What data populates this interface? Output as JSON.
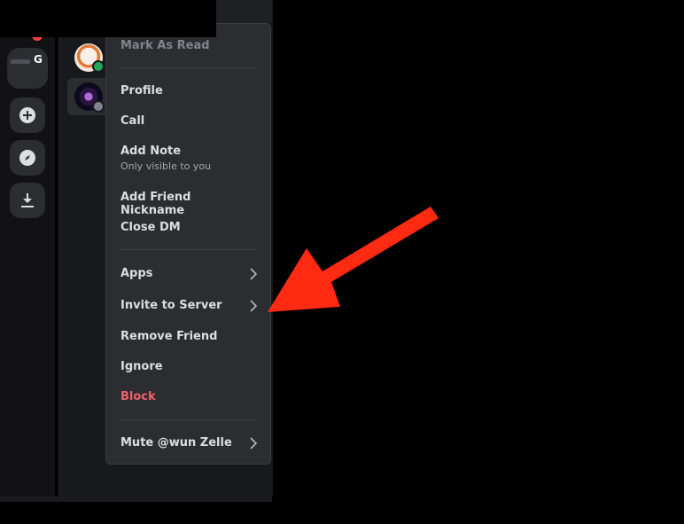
{
  "rail": {
    "server_letter": "G",
    "icons": [
      "add-server-icon",
      "discover-icon",
      "download-icon"
    ]
  },
  "menu": {
    "mark_as_read": "Mark As Read",
    "profile": "Profile",
    "call": "Call",
    "add_note": "Add Note",
    "add_note_sub": "Only visible to you",
    "add_friend_nickname": "Add Friend Nickname",
    "close_dm": "Close DM",
    "apps": "Apps",
    "invite_to_server": "Invite to Server",
    "remove_friend": "Remove Friend",
    "ignore": "Ignore",
    "block": "Block",
    "mute": "Mute @wun Zelle"
  },
  "colors": {
    "menu_bg": "#2b2d31",
    "danger": "#f2616b",
    "arrow": "#ff2a12",
    "online": "#23a55a"
  }
}
